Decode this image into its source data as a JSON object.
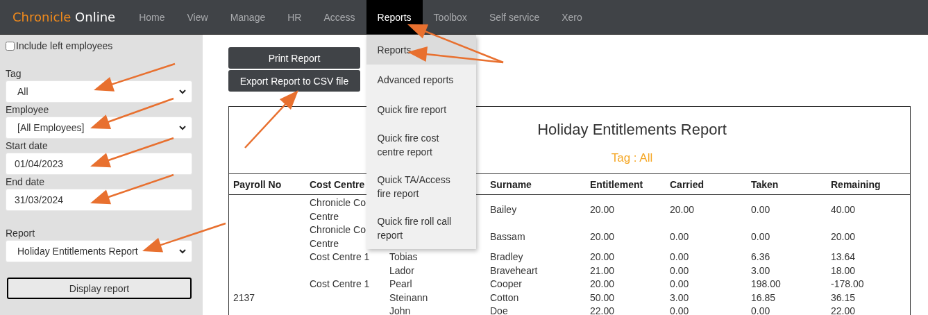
{
  "brand": {
    "part_1": "Chronicle",
    "part_2": "Online"
  },
  "nav": [
    {
      "label": "Home",
      "selected": false
    },
    {
      "label": "View",
      "selected": false
    },
    {
      "label": "Manage",
      "selected": false
    },
    {
      "label": "HR",
      "selected": false
    },
    {
      "label": "Access",
      "selected": false
    },
    {
      "label": "Reports",
      "selected": true
    },
    {
      "label": "Toolbox",
      "selected": false
    },
    {
      "label": "Self service",
      "selected": false
    },
    {
      "label": "Xero",
      "selected": false
    }
  ],
  "menu": [
    {
      "label": "Reports",
      "selected": true
    },
    {
      "label": "Advanced reports",
      "selected": false
    },
    {
      "label": "Quick fire report",
      "selected": false
    },
    {
      "label": "Quick fire cost centre report",
      "selected": false
    },
    {
      "label": "Quick TA/Access fire report",
      "selected": false
    },
    {
      "label": "Quick fire roll call report",
      "selected": false
    }
  ],
  "sidebar": {
    "include_left": {
      "label": "Include left employees",
      "checked": false
    },
    "fields": [
      {
        "kind": "select",
        "label": "Tag",
        "value": "All"
      },
      {
        "kind": "select",
        "label": "Employee",
        "value": "[All Employees]"
      },
      {
        "kind": "date",
        "label": "Start date",
        "value": "01/04/2023"
      },
      {
        "kind": "date",
        "label": "End date",
        "value": "31/03/2024"
      },
      {
        "kind": "select",
        "label": "Report",
        "value": "Holiday Entitlements Report"
      }
    ],
    "display_button": "Display report"
  },
  "actions": [
    "Print Report",
    "Export Report to CSV file"
  ],
  "report": {
    "title": "Holiday Entitlements Report",
    "subtitle": "Tag : All",
    "columns": [
      "Payroll No",
      "Cost Centre",
      "",
      "Surname",
      "Entitlement",
      "Carried",
      "Taken",
      "Remaining"
    ],
    "rows": [
      {
        "cells": [
          "",
          [
            "Chronicle Co",
            "Centre"
          ],
          "",
          "Bailey",
          "20.00",
          "20.00",
          "0.00",
          "40.00"
        ]
      },
      {
        "cells": [
          "",
          [
            "Chronicle Co",
            "Centre"
          ],
          "",
          "Bassam",
          "20.00",
          "0.00",
          "0.00",
          "20.00"
        ]
      },
      {
        "cells": [
          "",
          [
            "Cost Centre 1"
          ],
          "Tobias",
          "Bradley",
          "20.00",
          "0.00",
          "6.36",
          "13.64"
        ]
      },
      {
        "cells": [
          "",
          [],
          "Lador",
          "Braveheart",
          "21.00",
          "0.00",
          "3.00",
          "18.00"
        ]
      },
      {
        "cells": [
          "",
          [
            "Cost Centre 1"
          ],
          "Pearl",
          "Cooper",
          "20.00",
          "0.00",
          "198.00",
          "-178.00"
        ]
      },
      {
        "cells": [
          "2137",
          [],
          "Steinann",
          "Cotton",
          "50.00",
          "3.00",
          "16.85",
          "36.15"
        ]
      },
      {
        "cells": [
          "",
          [],
          "John",
          "Doe",
          "22.00",
          "0.00",
          "0.00",
          "22.00"
        ]
      }
    ]
  }
}
